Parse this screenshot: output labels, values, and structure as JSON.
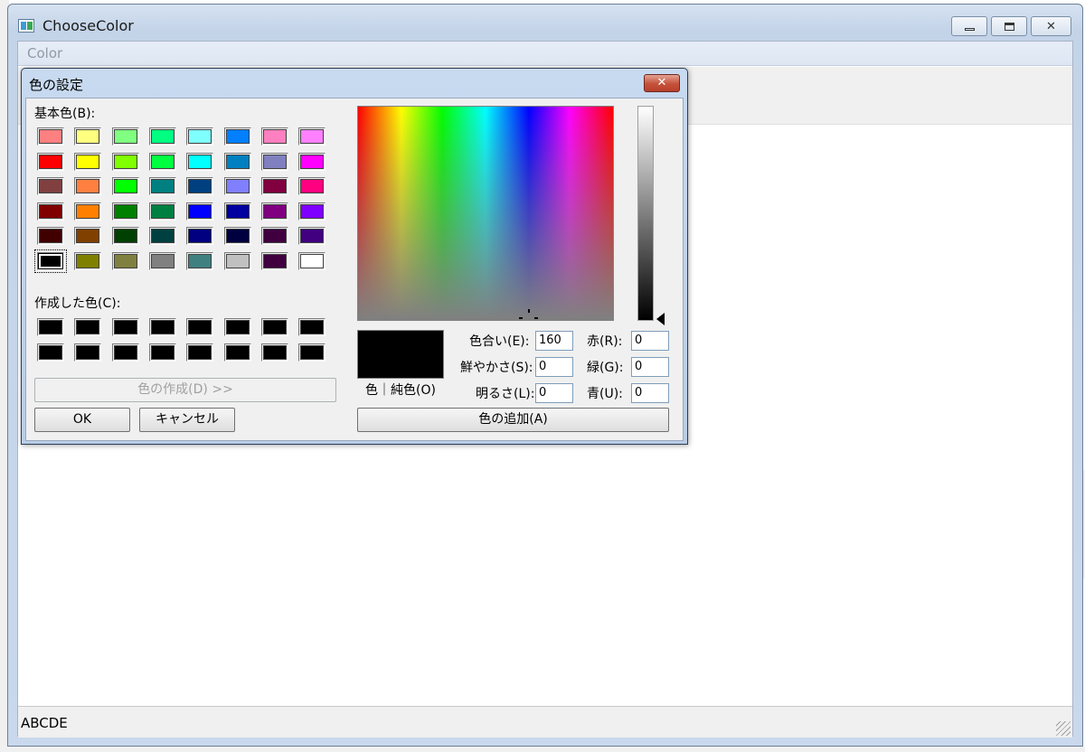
{
  "window": {
    "title": "ChooseColor",
    "menu": [
      "Color"
    ],
    "status_text": "ABCDE"
  },
  "dialog": {
    "title": "色の設定",
    "close_glyph": "✕",
    "basic_colors_label": "基本色(B):",
    "custom_colors_label": "作成した色(C):",
    "define_custom_button": "色の作成(D) >>",
    "ok_button": "OK",
    "cancel_button": "キャンセル",
    "add_custom_button": "色の追加(A)",
    "preview_label": "色｜純色(O)",
    "hue_label": "色合い(E):",
    "hue_value": "160",
    "sat_label": "鮮やかさ(S):",
    "sat_value": "0",
    "lum_label": "明るさ(L):",
    "lum_value": "0",
    "red_label": "赤(R):",
    "red_value": "0",
    "green_label": "緑(G):",
    "green_value": "0",
    "blue_label": "青(U):",
    "blue_value": "0",
    "current_color": "#000000",
    "basic_colors": [
      "#ff8080",
      "#ffff80",
      "#80ff80",
      "#00ff80",
      "#80ffff",
      "#0080ff",
      "#ff80c0",
      "#ff80ff",
      "#ff0000",
      "#ffff00",
      "#80ff00",
      "#00ff40",
      "#00ffff",
      "#0080c0",
      "#8080c0",
      "#ff00ff",
      "#804040",
      "#ff8040",
      "#00ff00",
      "#008080",
      "#004080",
      "#8080ff",
      "#800040",
      "#ff0080",
      "#800000",
      "#ff8000",
      "#008000",
      "#008040",
      "#0000ff",
      "#0000a0",
      "#800080",
      "#8000ff",
      "#400000",
      "#804000",
      "#004000",
      "#004040",
      "#000080",
      "#000040",
      "#400040",
      "#400080",
      "#000000",
      "#808000",
      "#808040",
      "#808080",
      "#408080",
      "#c0c0c0",
      "#400040",
      "#ffffff"
    ],
    "selected_basic_index": 40,
    "custom_colors": [
      "#000000",
      "#000000",
      "#000000",
      "#000000",
      "#000000",
      "#000000",
      "#000000",
      "#000000",
      "#000000",
      "#000000",
      "#000000",
      "#000000",
      "#000000",
      "#000000",
      "#000000",
      "#000000"
    ]
  }
}
